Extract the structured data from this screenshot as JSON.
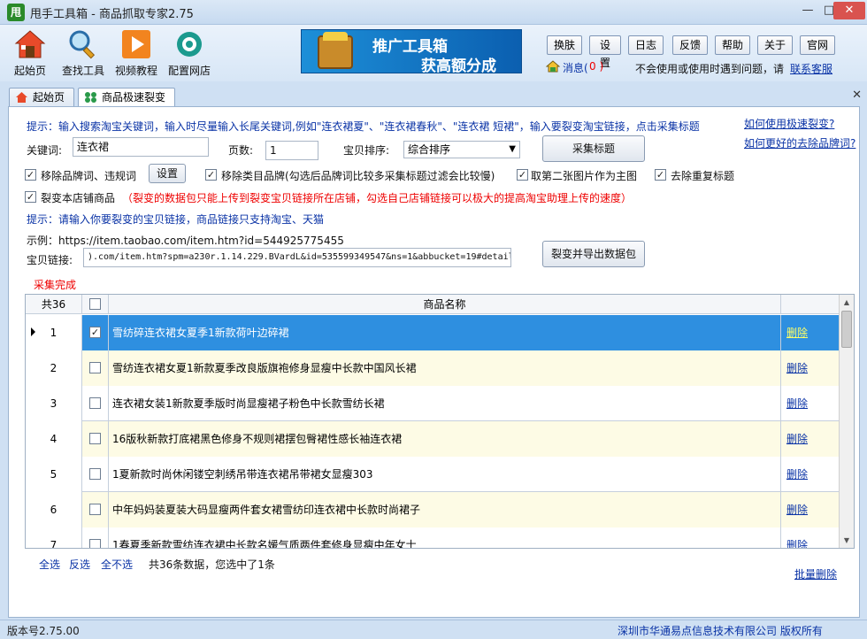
{
  "window": {
    "logo": "甩",
    "title": "甩手工具箱 - 商品抓取专家2.75"
  },
  "toolbar": {
    "items": [
      {
        "label": "起始页"
      },
      {
        "label": "查找工具"
      },
      {
        "label": "视频教程"
      },
      {
        "label": "配置网店"
      }
    ],
    "promo_line1": "推广工具箱",
    "promo_line2": "获高额分成",
    "buttons": [
      "换肤",
      "设置",
      "日志",
      "反馈",
      "帮助",
      "关于",
      "官网"
    ],
    "msg_label": "消息(",
    "msg_count": "0 )",
    "help_text": "不会使用或使用时遇到问题，请",
    "support_link": "联系客服"
  },
  "tabs": [
    {
      "label": "起始页"
    },
    {
      "label": "商品极速裂变"
    }
  ],
  "form": {
    "hint1": "提示：输入搜索淘宝关键词，输入时尽量输入长尾关键词,例如\"连衣裙夏\"、\"连衣裙春秋\"、\"连衣裙 短裙\"，输入要裂变淘宝链接，点击采集标题",
    "link_how": "如何使用极速裂变?",
    "link_brand": "如何更好的去除品牌词?",
    "keyword_label": "关键词:",
    "keyword_value": "连衣裙",
    "pages_label": "页数:",
    "pages_value": "1",
    "sort_label": "宝贝排序:",
    "sort_value": "综合排序",
    "collect_button": "采集标题",
    "opt_remove_brand": "移除品牌词、违规词",
    "settings_button": "设置",
    "opt_remove_category_brand": "移除类目品牌(勾选后品牌词比较多采集标题过滤会比较慢)",
    "opt_second_image": "取第二张图片作为主图",
    "opt_dedupe": "去除重复标题",
    "opt_own_shop": "裂变本店铺商品",
    "warning": "（裂变的数据包只能上传到裂变宝贝链接所在店铺，勾选自己店铺链接可以极大的提高淘宝助理上传的速度）",
    "hint2": "提示：请输入你要裂变的宝贝链接，商品链接只支持淘宝、天猫",
    "example": "示例：https://item.taobao.com/item.htm?id=544925775455",
    "link_label": "宝贝链接:",
    "link_value": ").com/item.htm?spm=a230r.1.14.229.BVardL&id=535599349547&ns=1&abbucket=19#detail",
    "export_button": "裂变并导出数据包",
    "status": "采集完成"
  },
  "grid": {
    "count_header": "共36",
    "name_header": "商品名称",
    "delete_label": "删除",
    "rows": [
      {
        "num": "1",
        "name": "雪纺碎连衣裙女夏季1新款荷叶边碎裙",
        "checked": "✓"
      },
      {
        "num": "2",
        "name": "雪纺连衣裙女夏1新款夏季改良版旗袍修身显瘦中长款中国风长裙",
        "checked": ""
      },
      {
        "num": "3",
        "name": "连衣裙女装1新款夏季版时尚显瘦裙子粉色中长款雪纺长裙",
        "checked": ""
      },
      {
        "num": "4",
        "name": "16版秋新款打底裙黑色修身不规则裙摆包臀裙性感长袖连衣裙",
        "checked": ""
      },
      {
        "num": "5",
        "name": "1夏新款时尚休闲镂空刺绣吊带连衣裙吊带裙女显瘦303",
        "checked": ""
      },
      {
        "num": "6",
        "name": "中年妈妈装夏装大码显瘦两件套女裙雪纺印连衣裙中长款时尚裙子",
        "checked": ""
      },
      {
        "num": "7",
        "name": "1春夏季新款雪纺连衣裙中长款名媛气质两件套修身显瘦中年女士",
        "checked": ""
      }
    ]
  },
  "bottom": {
    "select_all": "全选",
    "invert": "反选",
    "select_none": "全不选",
    "summary": "共36条数据，您选中了1条",
    "batch_delete": "批量删除"
  },
  "statusbar": {
    "version": "版本号2.75.00",
    "copyright": "深圳市华通易点信息技术有限公司 版权所有"
  }
}
